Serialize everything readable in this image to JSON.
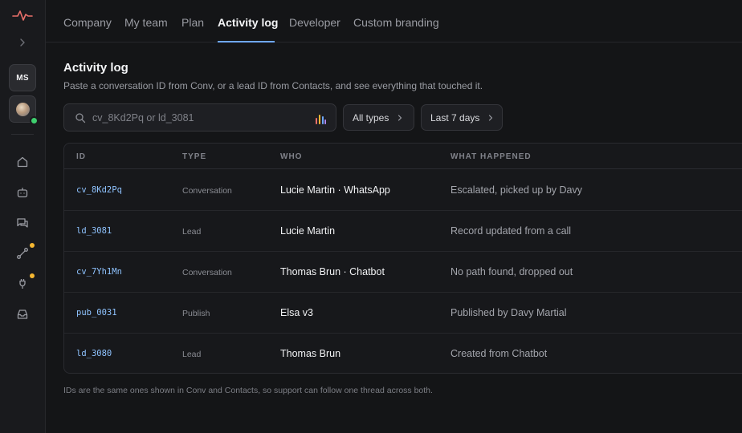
{
  "sidebar": {
    "account_initials": "MS",
    "icons": [
      "pulse-logo-icon",
      "chevron-right-icon",
      "home-icon",
      "bot-icon",
      "chat-icon",
      "flow-icon",
      "plug-icon",
      "inbox-icon"
    ]
  },
  "tabs": [
    {
      "label": "Company"
    },
    {
      "label": "My team"
    },
    {
      "label": "Plan"
    },
    {
      "label": "Activity log"
    },
    {
      "label": "Developer"
    },
    {
      "label": "Custom branding"
    }
  ],
  "page": {
    "title": "Activity log",
    "subtitle": "Paste a conversation ID from Conv, or a lead ID from Contacts, and see everything that touched it."
  },
  "search": {
    "placeholder": "cv_8Kd2Pq or ld_3081",
    "value": ""
  },
  "filters": {
    "type_label": "All types",
    "range_label": "Last 7 days"
  },
  "table": {
    "columns": [
      "ID",
      "TYPE",
      "WHO",
      "WHAT HAPPENED"
    ],
    "rows": [
      {
        "id": "cv_8Kd2Pq",
        "type": "Conversation",
        "who": "Lucie Martin · WhatsApp",
        "what": "Escalated, picked up by Davy"
      },
      {
        "id": "ld_3081",
        "type": "Lead",
        "who": "Lucie Martin",
        "what": "Record updated from a call"
      },
      {
        "id": "cv_7Yh1Mn",
        "type": "Conversation",
        "who": "Thomas Brun · Chatbot",
        "what": "No path found, dropped out"
      },
      {
        "id": "pub_0031",
        "type": "Publish",
        "who": "Elsa v3",
        "what": "Published by Davy Martial"
      },
      {
        "id": "ld_3080",
        "type": "Lead",
        "who": "Thomas Brun",
        "what": "Created from Chatbot"
      }
    ]
  },
  "footnote": "IDs are the same ones shown in Conv and Contacts, so support can follow one thread across both.",
  "colors": {
    "accent": "#6fa8ff",
    "online": "#3ecf6e",
    "notification": "#f5b731",
    "logo": "#e9706a"
  }
}
